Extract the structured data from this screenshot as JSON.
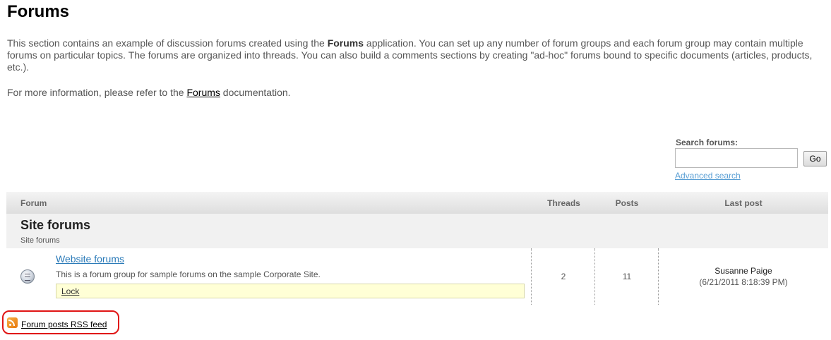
{
  "page": {
    "title": "Forums",
    "intro_before": "This section contains an example of discussion forums created using the ",
    "intro_bold": "Forums",
    "intro_after": " application. You can set up any number of forum groups and each forum group may contain multiple forums on particular topics. The forums are organized into threads. You can also build a comments sections by creating \"ad-hoc\" forums bound to specific documents (articles, products, etc.).",
    "more_before": "For more information, please refer to the ",
    "more_link": "Forums",
    "more_after": " documentation."
  },
  "search": {
    "label": "Search forums:",
    "value": "",
    "placeholder": "",
    "go_label": "Go",
    "advanced_label": "Advanced search"
  },
  "table": {
    "headers": {
      "forum": "Forum",
      "threads": "Threads",
      "posts": "Posts",
      "last_post": "Last post"
    },
    "group": {
      "title": "Site forums",
      "description": "Site forums"
    },
    "forums": [
      {
        "name": "Website forums",
        "description": "This is a forum group for sample forums on the sample Corporate Site.",
        "action": "Lock",
        "threads": "2",
        "posts": "11",
        "last_post_author": "Susanne Paige",
        "last_post_date": "(6/21/2011 8:18:39 PM)"
      }
    ]
  },
  "rss": {
    "label": "Forum posts RSS feed",
    "icon": "rss-icon"
  },
  "colors": {
    "link": "#2a7ab8",
    "highlight": "#e01515",
    "lock_bg": "#ffffd6"
  }
}
